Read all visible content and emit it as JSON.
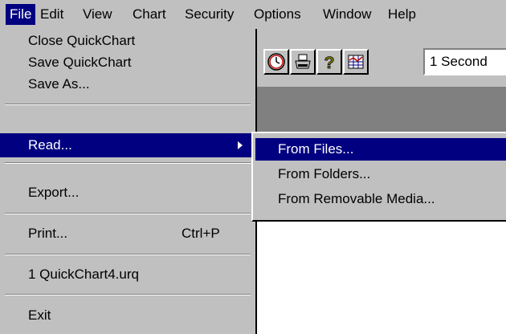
{
  "menubar": {
    "items": [
      {
        "label": "File",
        "active": true
      },
      {
        "label": "Edit"
      },
      {
        "label": "View"
      },
      {
        "label": "Chart"
      },
      {
        "label": "Security"
      },
      {
        "label": "Options"
      },
      {
        "label": "Window"
      },
      {
        "label": "Help"
      }
    ]
  },
  "toolbar": {
    "buttons": [
      {
        "icon": "clock-icon"
      },
      {
        "icon": "printer-icon"
      },
      {
        "icon": "help-icon"
      },
      {
        "icon": "chart-icon"
      }
    ],
    "interval_value": "1 Second"
  },
  "file_menu": {
    "items": [
      {
        "label": "Close QuickChart"
      },
      {
        "label": "Save QuickChart"
      },
      {
        "label": "Save As..."
      },
      {
        "label": "Read...",
        "selected": true,
        "has_submenu": true
      },
      {
        "label": "Export..."
      },
      {
        "label": "Print...",
        "shortcut": "Ctrl+P"
      },
      {
        "label": "1 QuickChart4.urq"
      },
      {
        "label": "Exit"
      }
    ]
  },
  "read_submenu": {
    "items": [
      {
        "label": "From Files...",
        "selected": true
      },
      {
        "label": "From Folders..."
      },
      {
        "label": "From Removable Media..."
      }
    ]
  },
  "colors": {
    "face": "#c0c0c0",
    "highlight": "#000080",
    "shadow": "#808080"
  }
}
